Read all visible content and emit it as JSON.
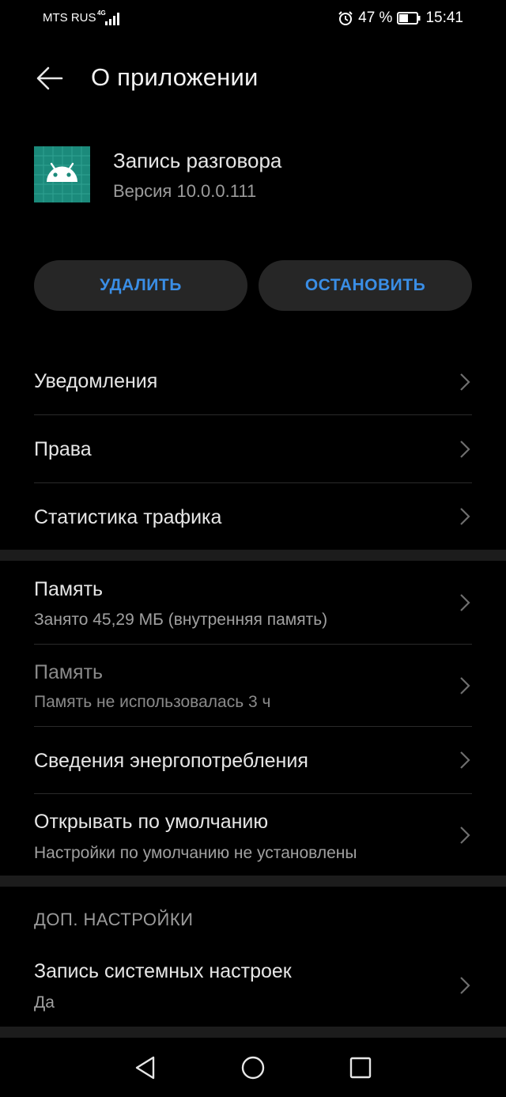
{
  "status_bar": {
    "carrier": "MTS RUS",
    "network": "4G",
    "battery": "47 %",
    "time": "15:41"
  },
  "header": {
    "title": "О приложении"
  },
  "app": {
    "name": "Запись разговора",
    "version": "Версия 10.0.0.111",
    "icon_color": "#1b8a7b"
  },
  "buttons": {
    "uninstall": "УДАЛИТЬ",
    "stop": "ОСТАНОВИТЬ",
    "accent": "#3a8ee6"
  },
  "section1": {
    "items": [
      {
        "label": "Уведомления"
      },
      {
        "label": "Права"
      },
      {
        "label": "Статистика трафика"
      }
    ]
  },
  "section2": {
    "items": [
      {
        "label": "Память",
        "sub": "Занято 45,29 МБ (внутренняя память)"
      },
      {
        "label": "Память",
        "sub": "Память не использовалась 3 ч"
      },
      {
        "label": "Сведения энергопотребления"
      },
      {
        "label": "Открывать по умолчанию",
        "sub": "Настройки по умолчанию не установлены"
      }
    ]
  },
  "section3": {
    "title": "ДОП. НАСТРОЙКИ",
    "items": [
      {
        "label": "Запись системных настроек",
        "sub": "Да"
      }
    ]
  },
  "navbar": {
    "icons": [
      "back-triangle-icon",
      "home-circle-icon",
      "recents-square-icon"
    ]
  }
}
